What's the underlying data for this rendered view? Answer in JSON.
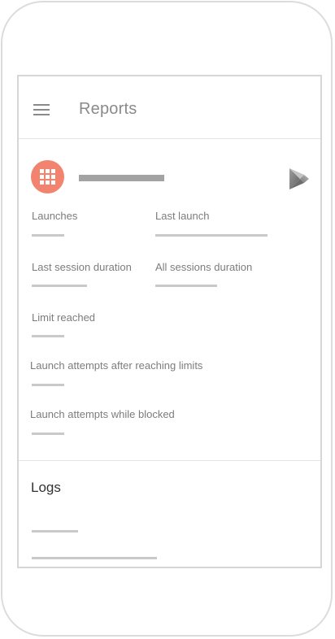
{
  "header": {
    "title": "Reports"
  },
  "colors": {
    "app_icon_bg": "#f2836f",
    "label_text": "#7c7c7c",
    "placeholder_bar": "#c9c9c9"
  },
  "stats": {
    "launches_label": "Launches",
    "last_launch_label": "Last launch",
    "last_session_duration_label": "Last session duration",
    "all_sessions_duration_label": "All sessions duration",
    "limit_reached_label": "Limit reached",
    "attempts_after_limits_label": "Launch attempts after reaching limits",
    "attempts_while_blocked_label": "Launch attempts while blocked"
  },
  "logs": {
    "title": "Logs"
  },
  "icons": {
    "menu": "hamburger-menu-icon",
    "app": "apps-grid-icon",
    "store": "play-store-icon"
  }
}
